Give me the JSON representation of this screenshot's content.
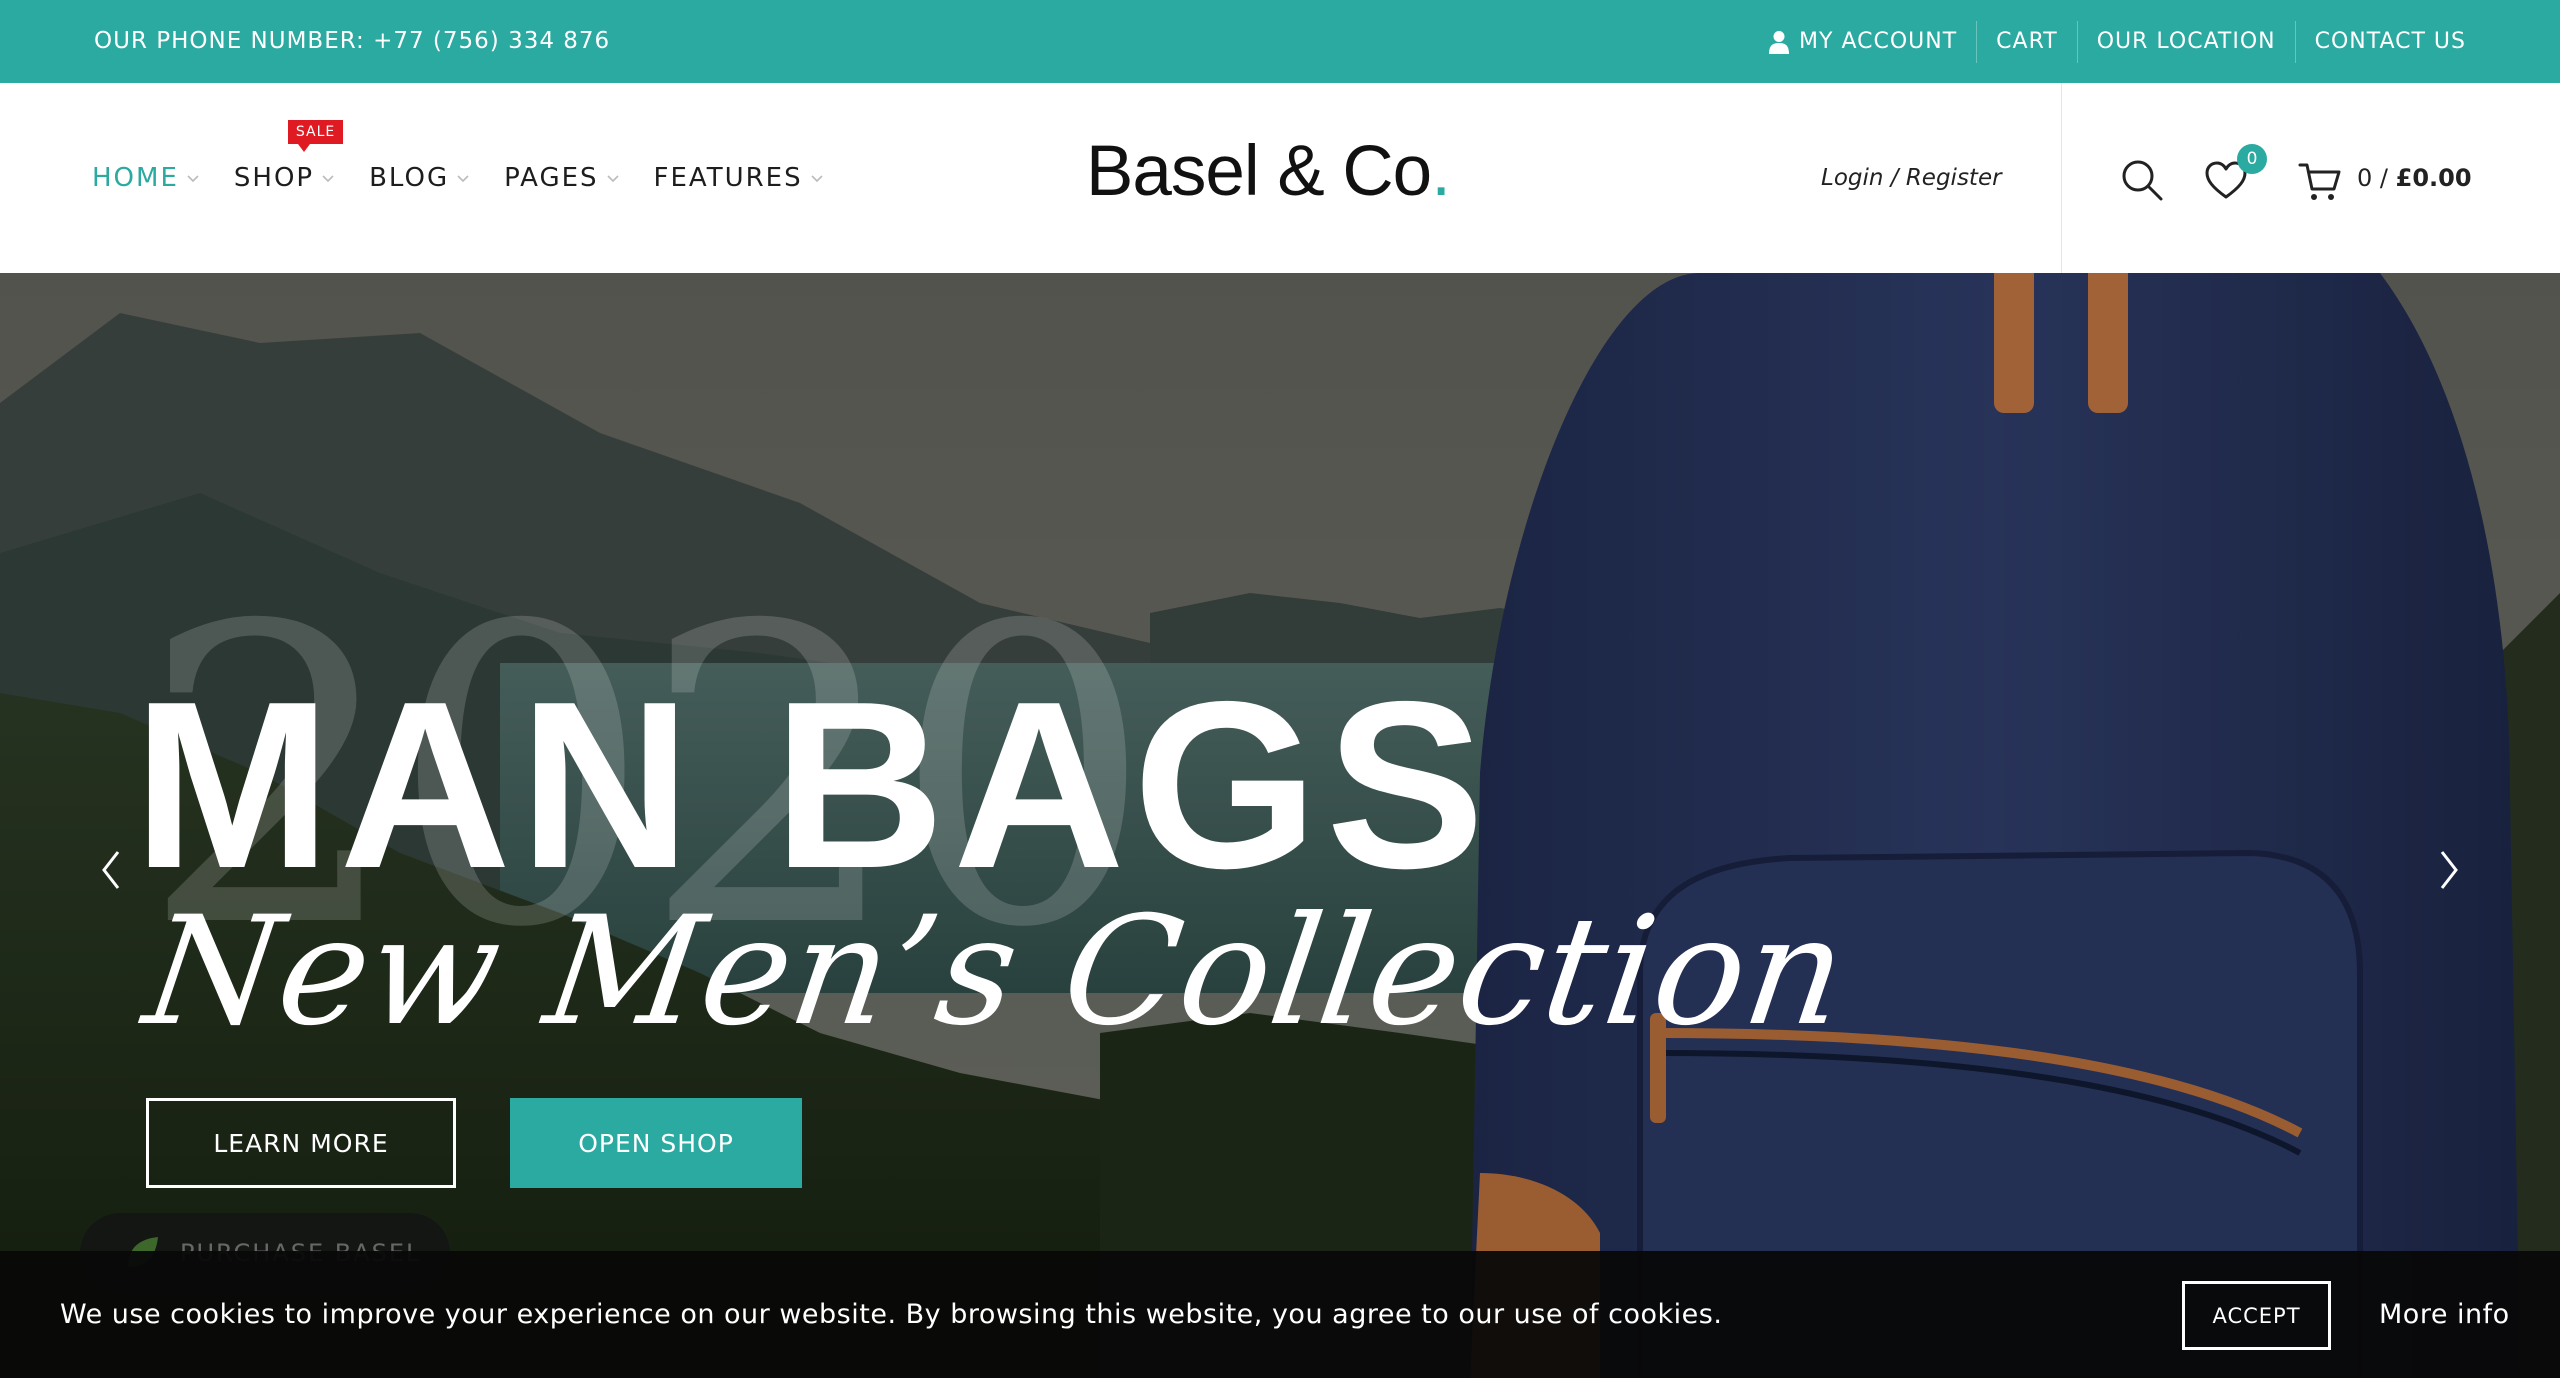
{
  "topbar": {
    "phone": "OUR PHONE NUMBER: +77 (756) 334 876",
    "links": [
      "MY ACCOUNT",
      "CART",
      "OUR LOCATION",
      "CONTACT US"
    ]
  },
  "nav": {
    "items": [
      {
        "label": "HOME",
        "active": true
      },
      {
        "label": "SHOP",
        "badge": "SALE"
      },
      {
        "label": "BLOG"
      },
      {
        "label": "PAGES"
      },
      {
        "label": "FEATURES"
      }
    ]
  },
  "logo": {
    "text": "Basel & Co",
    "dot": "."
  },
  "account": {
    "login_label": "Login / Register"
  },
  "wishlist": {
    "count": "0"
  },
  "cart": {
    "count": "0",
    "separator": "/",
    "total": "£0.00"
  },
  "hero": {
    "year": "2020",
    "headline": "MAN BAGS",
    "subheadline": "New Men’s Collection",
    "buttons": {
      "learn_more": "LEARN MORE",
      "open_shop": "OPEN SHOP"
    }
  },
  "purchase": {
    "label": "PURCHASE BASEL"
  },
  "cookie": {
    "message": "We use cookies to improve your experience on our website. By browsing this website, you agree to our use of cookies.",
    "accept": "ACCEPT",
    "more_info": "More info"
  },
  "colors": {
    "accent": "#2aaaa0",
    "sale_badge": "#e01a22",
    "cookie_bg": "#080808"
  },
  "icons": [
    "user-icon",
    "chevron-down-icon",
    "search-icon",
    "heart-icon",
    "cart-icon",
    "chevron-left-icon",
    "chevron-right-icon",
    "leaf-icon"
  ]
}
